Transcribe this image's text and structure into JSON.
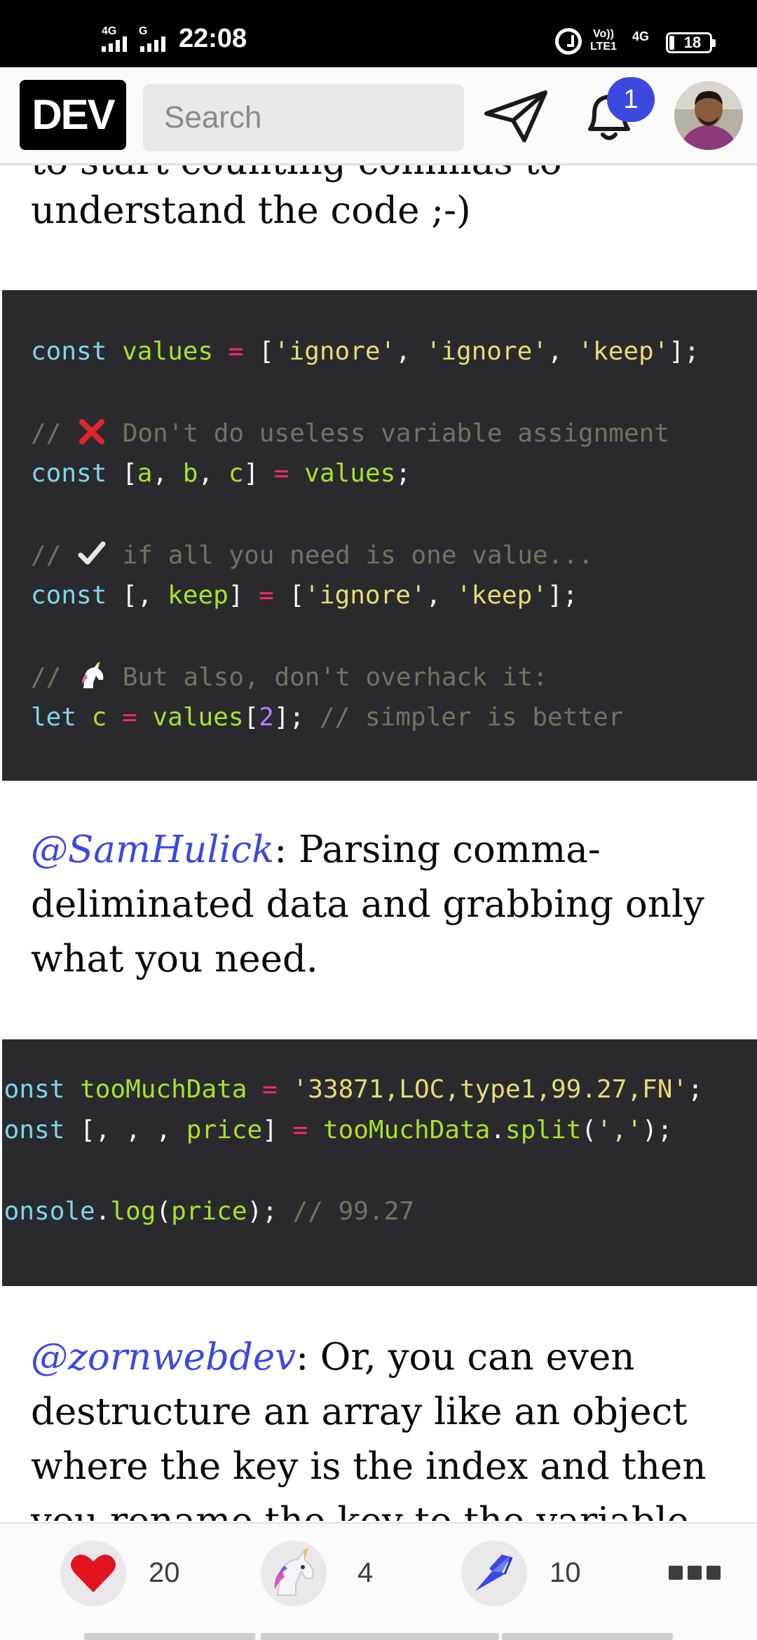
{
  "status_bar": {
    "network_left_1": "4G",
    "network_left_2": "G",
    "time": "22:08",
    "volte_top": "Vo))",
    "volte_bottom": "LTE1",
    "network_right": "4G",
    "battery": "18"
  },
  "header": {
    "logo": "DEV",
    "search_placeholder": "Search",
    "notification_count": "1"
  },
  "article": {
    "intro_partial_line": "to start counting commas to",
    "intro_last_line": "understand the code ;-)",
    "code_block_1": {
      "line1": {
        "kw": "const",
        "var": "values",
        "op": "=",
        "open": "[",
        "s1": "'ignore'",
        "c1": ", ",
        "s2": "'ignore'",
        "c2": ", ",
        "s3": "'keep'",
        "close": "];"
      },
      "line2": {
        "comment_pre": "// ",
        "emoji": "cross-mark",
        "comment": " Don't do useless variable assignment"
      },
      "line3": {
        "kw": "const",
        "open": "[",
        "a": "a",
        "c1": ", ",
        "b": "b",
        "c2": ", ",
        "c": "c",
        "close": "]",
        "op": "=",
        "var": "values",
        "end": ";"
      },
      "line4": {
        "comment_pre": "// ",
        "emoji": "check-mark",
        "comment": " if all you need is one value..."
      },
      "line5": {
        "kw": "const",
        "open": "[, ",
        "var": "keep",
        "close": "]",
        "op": "=",
        "open2": "[",
        "s1": "'ignore'",
        "c1": ", ",
        "s2": "'keep'",
        "close2": "];"
      },
      "line6": {
        "comment_pre": "// ",
        "emoji": "unicorn",
        "comment": " But also, don't overhack it:"
      },
      "line7": {
        "kw": "let",
        "var": "c",
        "op": "=",
        "var2": "values",
        "open": "[",
        "num": "2",
        "close": "];",
        "comment": "// simpler is better"
      }
    },
    "paragraph_2": {
      "mention": "@SamHulick",
      "line1_rest": ": Parsing comma-",
      "line2": "deliminated data and grabbing only",
      "line3": "what you need."
    },
    "code_block_2": {
      "line1": {
        "kw": "const",
        "var": "tooMuchData",
        "op": "=",
        "str": "'33871,LOC,type1,99.27,FN'",
        "end": ";"
      },
      "line2": {
        "kw": "const",
        "open": "[, , , ",
        "var": "price",
        "close": "]",
        "op": "=",
        "var2": "tooMuchData",
        "dot": ".",
        "fn": "split",
        "open2": "(",
        "str": "','",
        "close2": ");"
      },
      "line3": {
        "obj": "console",
        "dot": ".",
        "fn": "log",
        "open": "(",
        "var": "price",
        "close": ");",
        "comment": "// 99.27"
      }
    },
    "paragraph_3": {
      "mention": "@zornwebdev",
      "line1_rest": ": Or, you can even",
      "line2": "destructure an array like an object",
      "line3": "where the key is the index and then",
      "line4_partial": "you rename the key to the variable"
    }
  },
  "reactions": {
    "heart": {
      "icon": "heart-icon",
      "count": "20"
    },
    "unicorn": {
      "icon": "unicorn-icon",
      "count": "4"
    },
    "bookmark": {
      "icon": "bookmark-icon",
      "count": "10"
    }
  }
}
